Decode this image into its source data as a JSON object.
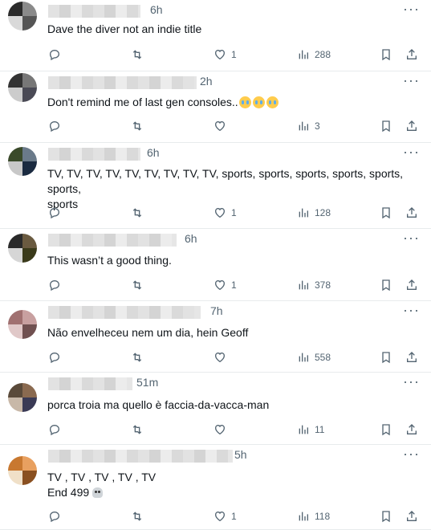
{
  "tweets": [
    {
      "time": "6h",
      "text": "Dave the diver not an indie title",
      "likes": "1",
      "views": "288"
    },
    {
      "time": "2h",
      "text": "Don't remind me of last gen consoles..",
      "emoji_count": 3,
      "likes": "",
      "views": "3"
    },
    {
      "time": "6h",
      "text": "TV, TV, TV, TV, TV, TV, TV, TV, TV, sports, sports, sports, sports, sports, sports,\nsports",
      "likes": "1",
      "views": "128"
    },
    {
      "time": "6h",
      "text": "This wasn’t a good thing.",
      "likes": "1",
      "views": "378"
    },
    {
      "time": "7h",
      "text": "Não envelheceu nem um dia, hein Geoff",
      "likes": "",
      "views": "558"
    },
    {
      "time": "51m",
      "text": "porca troia ma quello è faccia-da-vacca-man",
      "likes": "",
      "views": "11"
    },
    {
      "time": "5h",
      "text": "TV , TV , TV , TV , TV\nEnd 499",
      "likes": "1",
      "views": "118"
    }
  ],
  "icons": {
    "reply": "reply-icon",
    "retweet": "retweet-icon",
    "like": "heart-icon",
    "views": "views-icon",
    "bookmark": "bookmark-icon",
    "share": "share-icon",
    "more": "more-icon"
  },
  "colors": {
    "icon": "#536471",
    "text": "#0f1419",
    "divider": "#e8ebed"
  }
}
